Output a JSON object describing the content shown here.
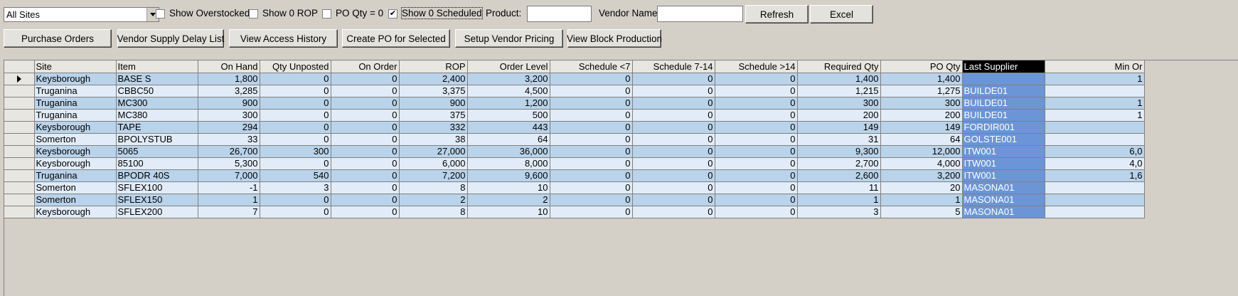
{
  "filter": {
    "site_select": "All Sites",
    "show_overstocked": {
      "label": "Show Overstocked",
      "checked": false
    },
    "show_zero_rop": {
      "label": "Show 0 ROP",
      "checked": false
    },
    "po_qty_zero": {
      "label": "PO Qty = 0",
      "checked": false
    },
    "show_zero_scheduled": {
      "label": "Show 0 Scheduled",
      "checked": true
    },
    "product_label": "Product:",
    "product_value": "",
    "vendor_label": "Vendor Name:",
    "vendor_value": "",
    "refresh_label": "Refresh",
    "excel_label": "Excel"
  },
  "toolbar": {
    "purchase_orders": "Purchase Orders",
    "vendor_supply_delay": "Vendor Supply Delay List",
    "view_access_history": "View Access History",
    "create_po": "Create PO for Selected",
    "setup_vendor_pricing": "Setup Vendor Pricing",
    "view_block_production": "View Block Production"
  },
  "grid": {
    "columns": [
      "Site",
      "Item",
      "On Hand",
      "Qty Unposted",
      "On Order",
      "ROP",
      "Order Level",
      "Schedule <7",
      "Schedule 7-14",
      "Schedule >14",
      "Required Qty",
      "PO Qty",
      "Last Supplier",
      "Min Or"
    ],
    "rows": [
      [
        "Keysborough",
        "BASE S",
        "1,800",
        "0",
        "0",
        "2,400",
        "3,200",
        "0",
        "0",
        "0",
        "1,400",
        "1,400",
        "",
        "1"
      ],
      [
        "Truganina",
        "CBBC50",
        "3,285",
        "0",
        "0",
        "3,375",
        "4,500",
        "0",
        "0",
        "0",
        "1,215",
        "1,275",
        "BUILDE01",
        ""
      ],
      [
        "Truganina",
        "MC300",
        "900",
        "0",
        "0",
        "900",
        "1,200",
        "0",
        "0",
        "0",
        "300",
        "300",
        "BUILDE01",
        "1"
      ],
      [
        "Truganina",
        "MC380",
        "300",
        "0",
        "0",
        "375",
        "500",
        "0",
        "0",
        "0",
        "200",
        "200",
        "BUILDE01",
        "1"
      ],
      [
        "Keysborough",
        "TAPE",
        "294",
        "0",
        "0",
        "332",
        "443",
        "0",
        "0",
        "0",
        "149",
        "149",
        "FORDIR001",
        ""
      ],
      [
        "Somerton",
        "BPOLYSTUB",
        "33",
        "0",
        "0",
        "38",
        "64",
        "0",
        "0",
        "0",
        "31",
        "64",
        "GOLSTE001",
        ""
      ],
      [
        "Keysborough",
        "5065",
        "26,700",
        "300",
        "0",
        "27,000",
        "36,000",
        "0",
        "0",
        "0",
        "9,300",
        "12,000",
        "ITW001",
        "6,0"
      ],
      [
        "Keysborough",
        "85100",
        "5,300",
        "0",
        "0",
        "6,000",
        "8,000",
        "0",
        "0",
        "0",
        "2,700",
        "4,000",
        "ITW001",
        "4,0"
      ],
      [
        "Truganina",
        "BPODR 40S",
        "7,000",
        "540",
        "0",
        "7,200",
        "9,600",
        "0",
        "0",
        "0",
        "2,600",
        "3,200",
        "ITW001",
        "1,6"
      ],
      [
        "Somerton",
        "SFLEX100",
        "-1",
        "3",
        "0",
        "8",
        "10",
        "0",
        "0",
        "0",
        "11",
        "20",
        "MASONA01",
        ""
      ],
      [
        "Somerton",
        "SFLEX150",
        "1",
        "0",
        "0",
        "2",
        "2",
        "0",
        "0",
        "0",
        "1",
        "1",
        "MASONA01",
        ""
      ],
      [
        "Keysborough",
        "SFLEX200",
        "7",
        "0",
        "0",
        "8",
        "10",
        "0",
        "0",
        "0",
        "3",
        "5",
        "MASONA01",
        ""
      ]
    ]
  },
  "colors": {
    "row_a": "#b9d3ea",
    "row_b": "#e1ecf8",
    "supplier_col": "#6b95d6"
  }
}
